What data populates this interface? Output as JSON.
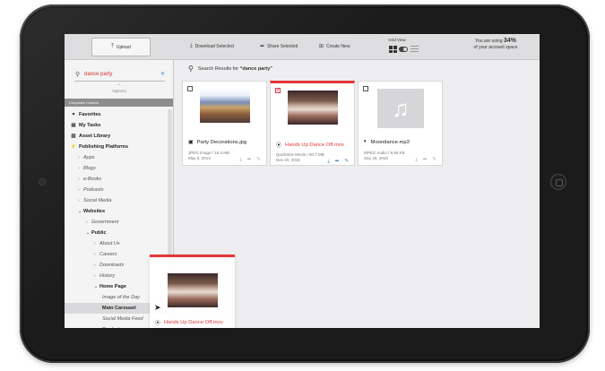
{
  "toolbar": {
    "upload": "Upload",
    "download_selected": "Download Selected",
    "share_selected": "Share Selected",
    "create_new": "Create New",
    "grid_view": "Grid View",
    "account_prefix": "You are using",
    "account_pct": "34%",
    "account_suffix": "of your account space"
  },
  "sidebar": {
    "search_value": "dance party",
    "options_label": "Options",
    "section_label": "Corporate Content",
    "items": [
      {
        "label": "Favorites",
        "icon": "heart-icon",
        "glyph": "♥",
        "indent": 0,
        "style": "bold"
      },
      {
        "label": "My Tasks",
        "icon": "list-icon",
        "glyph": "▤",
        "indent": 0,
        "style": "bold"
      },
      {
        "label": "Asset Library",
        "icon": "book-icon",
        "glyph": "▥",
        "indent": 0,
        "style": "bold"
      },
      {
        "label": "Publishing Platforms",
        "icon": "bolt-icon",
        "glyph": "⚡",
        "indent": 0,
        "style": "bold"
      },
      {
        "label": "Apps",
        "indent": 1,
        "style": "sub"
      },
      {
        "label": "Blogs",
        "indent": 1,
        "style": "sub"
      },
      {
        "label": "e-Books",
        "indent": 1,
        "style": "sub"
      },
      {
        "label": "Podcasts",
        "indent": 1,
        "style": "sub"
      },
      {
        "label": "Social Media",
        "indent": 1,
        "style": "sub"
      },
      {
        "label": "Websites",
        "indent": 1,
        "style": "bold",
        "open": true
      },
      {
        "label": "Government",
        "indent": 2,
        "style": "sub"
      },
      {
        "label": "Public",
        "indent": 2,
        "style": "bold",
        "open": true
      },
      {
        "label": "About Us",
        "indent": 3,
        "style": "sub"
      },
      {
        "label": "Careers",
        "indent": 3,
        "style": "sub"
      },
      {
        "label": "Downloads",
        "indent": 3,
        "style": "sub"
      },
      {
        "label": "History",
        "indent": 3,
        "style": "sub"
      },
      {
        "label": "Home Page",
        "indent": 3,
        "style": "bold",
        "open": true
      },
      {
        "label": "Image of the Day",
        "indent": 4,
        "style": "sub"
      },
      {
        "label": "Main Carousel",
        "indent": 4,
        "style": "active"
      },
      {
        "label": "Social Media Feed",
        "indent": 4,
        "style": "sub"
      },
      {
        "label": "Products",
        "indent": 4,
        "style": "sub"
      }
    ]
  },
  "results": {
    "prefix": "Search Results for",
    "query": "“dance party”"
  },
  "cards": [
    {
      "title": "Party Decorations.jpg",
      "type": "JPEG Image",
      "size": "15.4 MB",
      "date": "May 5, 2014",
      "icon": "image-icon",
      "selected": false
    },
    {
      "title": "Hands Up Dance Off.mov",
      "type": "Quicktime Movie",
      "size": "90.7 MB",
      "date": "Nov 20, 2016",
      "icon": "play-icon",
      "selected": true
    },
    {
      "title": "Moondance.mp3",
      "type": "MPEG Audio",
      "size": "9.56 KB",
      "date": "Sep 18, 2015",
      "icon": "audio-icon",
      "selected": false
    }
  ],
  "drag_ghost": {
    "title": "Hands Up Dance Off.mov"
  }
}
